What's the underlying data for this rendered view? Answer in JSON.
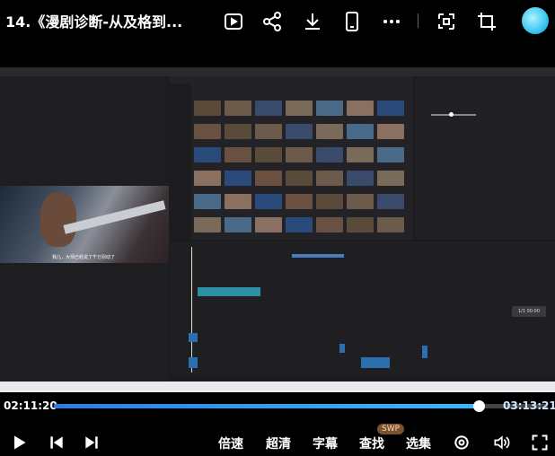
{
  "header": {
    "title": "14.《漫剧诊断-从及格到...",
    "icons": [
      "screen-record-icon",
      "share-icon",
      "download-icon",
      "phone-icon",
      "more-icon",
      "pip-icon",
      "crop-icon",
      "avatar"
    ]
  },
  "video": {
    "subtitle": "我儿，大师已经说了千万别动了",
    "side_badge": "1/1 00:00"
  },
  "player": {
    "current_time": "02:11:20",
    "total_time": "03:13:21",
    "progress_fraction": 0.86,
    "controls": {
      "speed": "倍速",
      "quality": "超清",
      "subtitles": "字幕",
      "find": "查找",
      "find_badge": "SWP",
      "episodes": "选集"
    }
  },
  "colors": {
    "accent": "#2f9bff",
    "background": "#000000"
  }
}
